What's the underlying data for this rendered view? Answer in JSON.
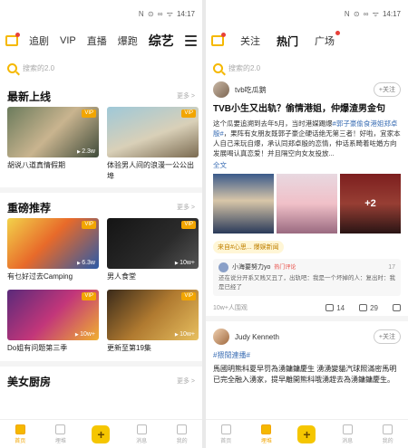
{
  "status": {
    "time": "14:17",
    "signal": "N ⊙ ∞ ᯤ"
  },
  "left": {
    "tabs": [
      "追剧",
      "VIP",
      "直播",
      "爆跑",
      "综艺"
    ],
    "active_tab": "综艺",
    "search_placeholder": "搜索的2.0",
    "sections": [
      {
        "title": "最新上线",
        "more": "更多 >",
        "items": [
          {
            "title": "胡说八道真情假期",
            "badge": "VIP",
            "count": "2.3w"
          },
          {
            "title": "体验男人间的浪漫一公公出埠",
            "badge": "VIP",
            "count": ""
          }
        ]
      },
      {
        "title": "重磅推荐",
        "more": "更多 >",
        "items": [
          {
            "title": "有乜好过去Camping",
            "badge": "VIP",
            "count": "6.3w"
          },
          {
            "title": "男人食堂",
            "badge": "VIP",
            "count": "10w+"
          },
          {
            "title": "Do姐有问题第三季",
            "badge": "VIP",
            "count": "10w+"
          },
          {
            "title": "更新至第19集",
            "badge": "VIP",
            "count": "10w+"
          }
        ]
      },
      {
        "title": "美女厨房",
        "more": "更多 >",
        "items": []
      }
    ],
    "bottom_tabs": [
      {
        "label": "首页",
        "active": true
      },
      {
        "label": "埋堆",
        "active": false
      },
      {
        "label": "+",
        "active": false
      },
      {
        "label": "消息",
        "active": false
      },
      {
        "label": "我的",
        "active": false
      }
    ]
  },
  "right": {
    "tabs": [
      "关注",
      "热门",
      "广场"
    ],
    "active_tab": "热门",
    "search_placeholder": "搜索的2.0",
    "post1": {
      "author": "tvb吃瓜鹅",
      "follow": "+关注",
      "title": "TVB小生又出轨？偷情港姐，仲爆渣男金句",
      "body_pre": "这个瓜要追溯到去年5月，当时港媒踢爆",
      "body_hl": "#郭子豪偷食港姐郑卓殷#",
      "body_post": "，果阵有女朋友既郭子豪企硬话绝无第三者！好啦，宜家本人自己来玩自爆，承认同郑卓殷的恋情，仲话系畸着咗婚方向发展喝认真恋爱！并且隔空向女友投放...",
      "full": "全文",
      "more_pics": "+2",
      "topic": "来自#心思... 爆娱新闻",
      "comment_user": "小海要努力yo",
      "comment_tag": "热门评论",
      "comment_like": "17",
      "comment_text": "还在说分开系又贱又丑了，出轨吧：我是一个坏掉的人：复出时：我是已经了",
      "views": "10w+人围观",
      "likes": "14",
      "comments": "29"
    },
    "post2": {
      "names": "Judy Kenneth",
      "follow": "+关注",
      "tag": "#猥閒連播#",
      "body": "馬國明熊科夏早罚為湧鏞鏞慶生 湧湧變貓汽球照滿密馬明已完全融入湧家，提早離開熊科哦湧趕去為湧鏞鏞慶生。"
    },
    "bottom_tabs": [
      {
        "label": "首页",
        "active": false
      },
      {
        "label": "埋堆",
        "active": true
      },
      {
        "label": "+",
        "active": false
      },
      {
        "label": "消息",
        "active": false
      },
      {
        "label": "我的",
        "active": false
      }
    ]
  }
}
